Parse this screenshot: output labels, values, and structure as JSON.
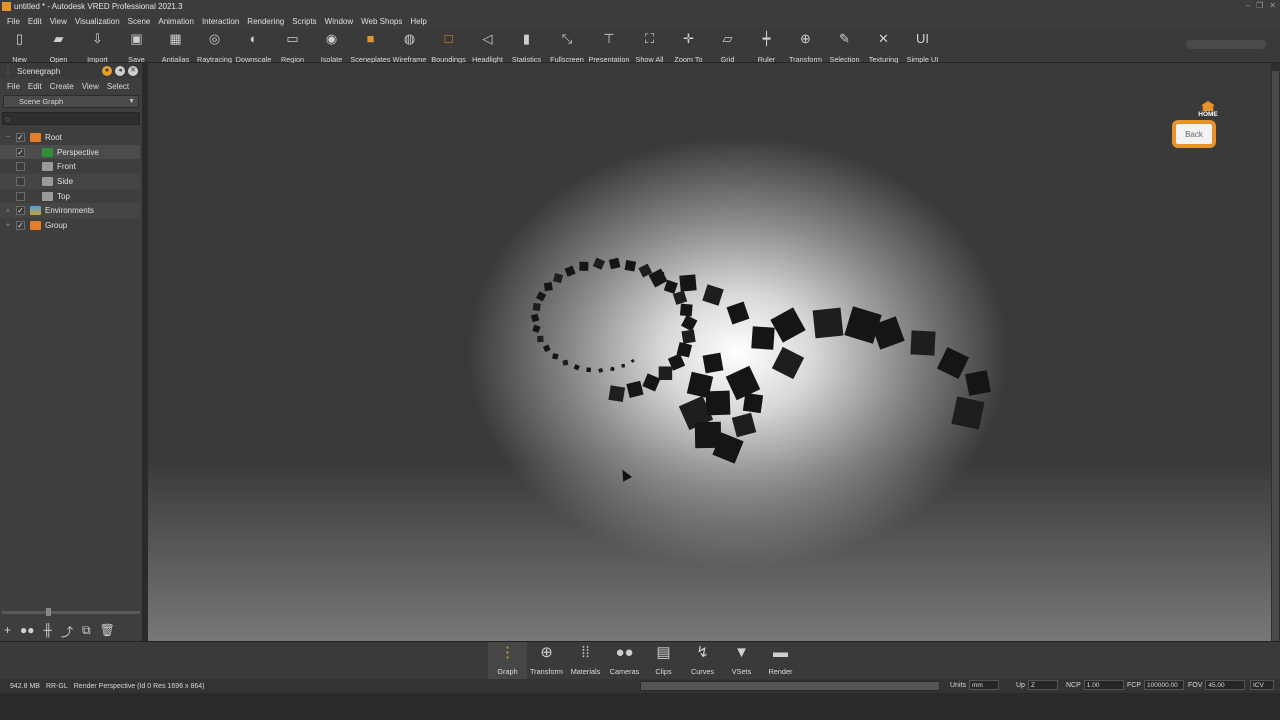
{
  "window": {
    "title": "untitled * - Autodesk VRED Professional 2021.3"
  },
  "menubar": [
    "File",
    "Edit",
    "View",
    "Visualization",
    "Scene",
    "Animation",
    "Interaction",
    "Rendering",
    "Scripts",
    "Window",
    "Web Shops",
    "Help"
  ],
  "toolbar": [
    {
      "label": "New",
      "icon": "new-file-icon"
    },
    {
      "label": "Open",
      "icon": "open-folder-icon"
    },
    {
      "label": "Import",
      "icon": "import-icon"
    },
    {
      "label": "Save",
      "icon": "save-icon"
    },
    {
      "label": "Antialias",
      "icon": "antialias-icon"
    },
    {
      "label": "Raytracing",
      "icon": "raytracing-icon"
    },
    {
      "label": "Downscale",
      "icon": "downscale-icon"
    },
    {
      "label": "Region",
      "icon": "region-icon"
    },
    {
      "label": "Isolate",
      "icon": "isolate-icon"
    },
    {
      "label": "Sceneplates",
      "icon": "sceneplates-icon"
    },
    {
      "label": "Wireframe",
      "icon": "wireframe-icon"
    },
    {
      "label": "Boundings",
      "icon": "boundings-icon"
    },
    {
      "label": "Headlight",
      "icon": "headlight-icon"
    },
    {
      "label": "Statistics",
      "icon": "statistics-icon"
    },
    {
      "label": "Fullscreen",
      "icon": "fullscreen-icon"
    },
    {
      "label": "Presentation",
      "icon": "presentation-icon"
    },
    {
      "label": "Show All",
      "icon": "show-all-icon"
    },
    {
      "label": "Zoom To",
      "icon": "zoom-to-icon"
    },
    {
      "label": "Grid",
      "icon": "grid-icon"
    },
    {
      "label": "Ruler",
      "icon": "ruler-icon"
    },
    {
      "label": "Transform",
      "icon": "transform-icon"
    },
    {
      "label": "Selection",
      "icon": "selection-icon"
    },
    {
      "label": "Texturing",
      "icon": "texturing-icon"
    },
    {
      "label": "Simple UI",
      "icon": "simple-ui-icon"
    }
  ],
  "scenegraph": {
    "title": "Scenegraph",
    "menu": [
      "File",
      "Edit",
      "Create",
      "View",
      "Select"
    ],
    "view_select": "Scene Graph",
    "tree": [
      {
        "label": "Root",
        "expand": "−",
        "checked": true,
        "icon": "or"
      },
      {
        "label": "Perspective",
        "expand": "",
        "checked": true,
        "icon": "gr"
      },
      {
        "label": "Front",
        "expand": "",
        "checked": false,
        "icon": "gy"
      },
      {
        "label": "Side",
        "expand": "",
        "checked": false,
        "icon": "gy"
      },
      {
        "label": "Top",
        "expand": "",
        "checked": false,
        "icon": "gy"
      },
      {
        "label": "Environments",
        "expand": "+",
        "checked": true,
        "icon": "env"
      },
      {
        "label": "Group",
        "expand": "+",
        "checked": true,
        "icon": "or"
      }
    ]
  },
  "navcube": {
    "home": "HOME",
    "face": "Back"
  },
  "dock": [
    {
      "label": "Graph",
      "icon": "graph-icon",
      "active": true
    },
    {
      "label": "Transform",
      "icon": "transform-icon",
      "active": false
    },
    {
      "label": "Materials",
      "icon": "materials-icon",
      "active": false
    },
    {
      "label": "Cameras",
      "icon": "cameras-icon",
      "active": false
    },
    {
      "label": "Clips",
      "icon": "clips-icon",
      "active": false
    },
    {
      "label": "Curves",
      "icon": "curves-icon",
      "active": false
    },
    {
      "label": "VSets",
      "icon": "vsets-icon",
      "active": false
    },
    {
      "label": "Render",
      "icon": "render-icon",
      "active": false
    }
  ],
  "status": {
    "memory": "942.8 MB",
    "renderer": "RR-GL",
    "info": "Render Perspective (Id 0 Res 1696 x 864)",
    "units_label": "Units",
    "units_value": "mm",
    "up_label": "Up",
    "up_value": "Z",
    "ncp_label": "NCP",
    "ncp_value": "1.00",
    "fcp_label": "FCP",
    "fcp_value": "100000.00",
    "fov_label": "FOV",
    "fov_value": "45.00",
    "icv": "ICV"
  },
  "colors": {
    "accent": "#e7932b",
    "panel": "#3e3e3e",
    "viewport_light": "#ffffff",
    "viewport_dark": "#2f2f2f"
  }
}
